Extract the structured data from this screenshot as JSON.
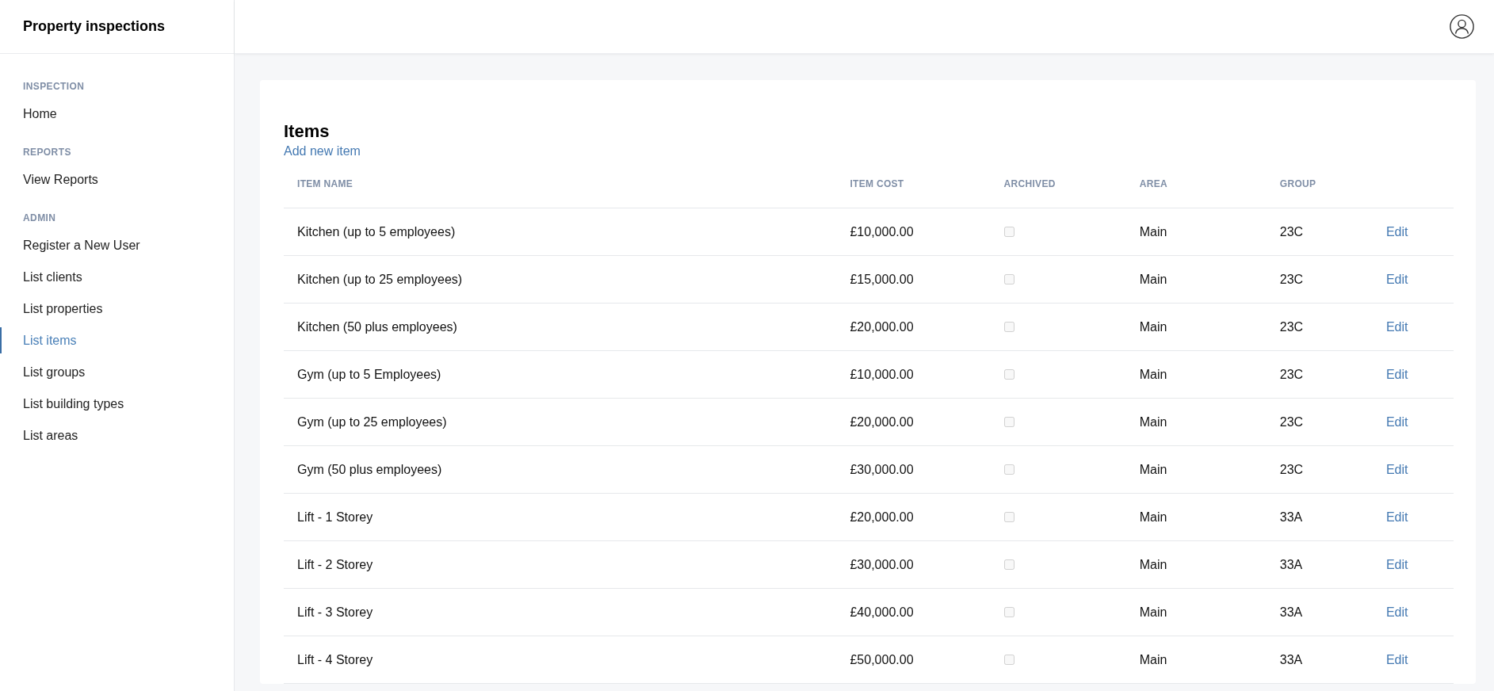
{
  "app": {
    "title": "Property inspections"
  },
  "sidebar": {
    "sections": [
      {
        "heading": "INSPECTION",
        "items": [
          {
            "label": "Home",
            "selected": false
          }
        ]
      },
      {
        "heading": "REPORTS",
        "items": [
          {
            "label": "View Reports",
            "selected": false
          }
        ]
      },
      {
        "heading": "ADMIN",
        "items": [
          {
            "label": "Register a New User",
            "selected": false
          },
          {
            "label": "List clients",
            "selected": false
          },
          {
            "label": "List properties",
            "selected": false
          },
          {
            "label": "List items",
            "selected": true
          },
          {
            "label": "List groups",
            "selected": false
          },
          {
            "label": "List building types",
            "selected": false
          },
          {
            "label": "List areas",
            "selected": false
          }
        ]
      }
    ]
  },
  "page": {
    "title": "Items",
    "add_link": "Add new item"
  },
  "table": {
    "columns": [
      "ITEM NAME",
      "ITEM COST",
      "ARCHIVED",
      "AREA",
      "GROUP"
    ],
    "rows": [
      {
        "item_name": "Kitchen (up to 5 employees)",
        "item_cost": "£10,000.00",
        "archived": false,
        "area": "Main",
        "group": "23C",
        "action": "Edit"
      },
      {
        "item_name": "Kitchen (up to 25 employees)",
        "item_cost": "£15,000.00",
        "archived": false,
        "area": "Main",
        "group": "23C",
        "action": "Edit"
      },
      {
        "item_name": "Kitchen (50 plus employees)",
        "item_cost": "£20,000.00",
        "archived": false,
        "area": "Main",
        "group": "23C",
        "action": "Edit"
      },
      {
        "item_name": "Gym (up to 5 Employees)",
        "item_cost": "£10,000.00",
        "archived": false,
        "area": "Main",
        "group": "23C",
        "action": "Edit"
      },
      {
        "item_name": "Gym (up to 25 employees)",
        "item_cost": "£20,000.00",
        "archived": false,
        "area": "Main",
        "group": "23C",
        "action": "Edit"
      },
      {
        "item_name": "Gym (50 plus employees)",
        "item_cost": "£30,000.00",
        "archived": false,
        "area": "Main",
        "group": "23C",
        "action": "Edit"
      },
      {
        "item_name": "Lift - 1 Storey",
        "item_cost": "£20,000.00",
        "archived": false,
        "area": "Main",
        "group": "33A",
        "action": "Edit"
      },
      {
        "item_name": "Lift - 2 Storey",
        "item_cost": "£30,000.00",
        "archived": false,
        "area": "Main",
        "group": "33A",
        "action": "Edit"
      },
      {
        "item_name": "Lift - 3 Storey",
        "item_cost": "£40,000.00",
        "archived": false,
        "area": "Main",
        "group": "33A",
        "action": "Edit"
      },
      {
        "item_name": "Lift - 4 Storey",
        "item_cost": "£50,000.00",
        "archived": false,
        "area": "Main",
        "group": "33A",
        "action": "Edit"
      }
    ]
  }
}
